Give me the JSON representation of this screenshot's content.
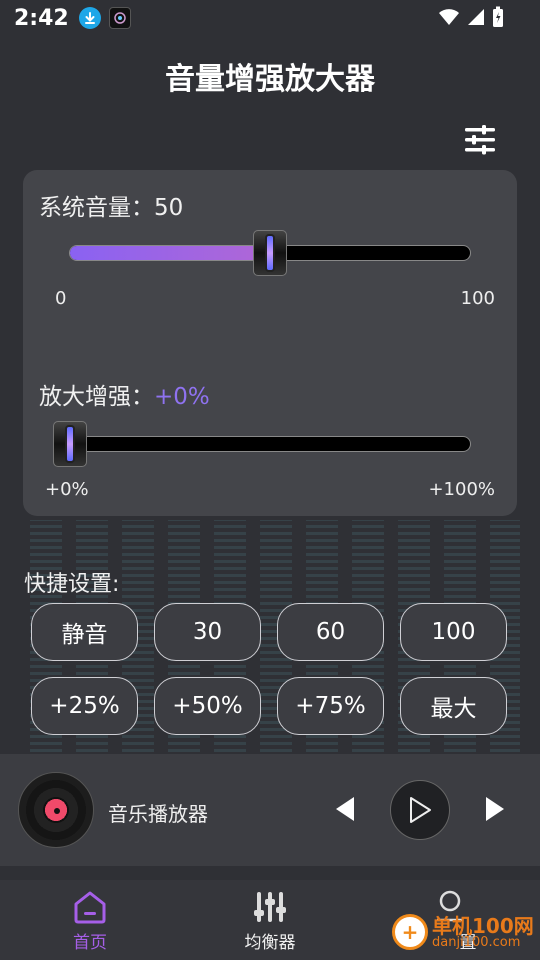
{
  "status_bar": {
    "time": "2:42",
    "icons": [
      "download-icon",
      "app-icon",
      "wifi-icon",
      "signal-icon",
      "battery-icon"
    ]
  },
  "header": {
    "title": "音量增强放大器",
    "settings_icon": "sliders-icon"
  },
  "system_volume": {
    "label": "系统音量：",
    "value": "50",
    "level": 0.5,
    "min_label": "0",
    "max_label": "100"
  },
  "boost": {
    "label": "放大增强：",
    "value": "+0%",
    "level": 0,
    "min_label": "+0%",
    "max_label": "+100%"
  },
  "quick": {
    "title": "快捷设置:",
    "buttons": [
      "静音",
      "30",
      "60",
      "100",
      "+25%",
      "+50%",
      "+75%",
      "最大"
    ]
  },
  "player": {
    "title": "音乐播放器",
    "prev_icon": "prev-icon",
    "play_icon": "play-icon",
    "next_icon": "next-icon"
  },
  "nav": {
    "items": [
      {
        "label": "首页",
        "icon": "home-icon"
      },
      {
        "label": "均衡器",
        "icon": "equalizer-icon"
      },
      {
        "label": "置",
        "icon": "user-icon"
      }
    ]
  },
  "watermark": {
    "name": "单机100网",
    "url": "danji100.com"
  },
  "colors": {
    "accent": "#8f72f0",
    "nav_active": "#a65fe8",
    "background": "#2f3035",
    "card": "#44454a"
  }
}
